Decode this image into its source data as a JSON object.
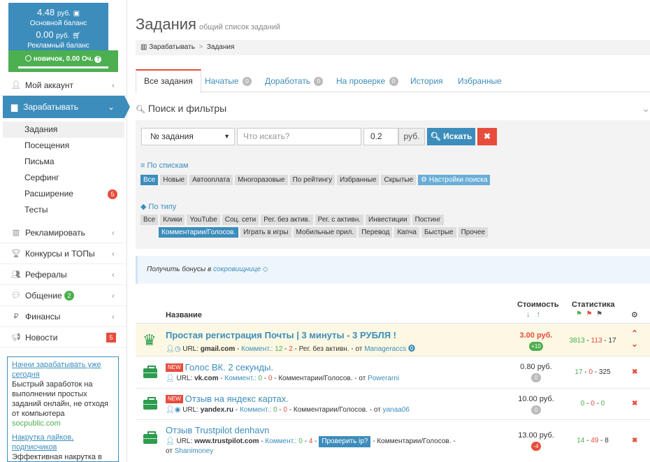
{
  "balance": {
    "main_amount": "4.48",
    "main_currency": "руб.",
    "main_label": "Основной баланс",
    "ad_amount": "0.00",
    "ad_currency": "руб.",
    "ad_label": "Рекламный баланс",
    "status": "новичок, 0.00 Оч."
  },
  "sidebar": {
    "items": [
      {
        "label": "Мой аккаунт"
      },
      {
        "label": "Зарабатывать"
      },
      {
        "label": "Рекламировать"
      },
      {
        "label": "Конкурсы и ТОПы"
      },
      {
        "label": "Рефералы"
      },
      {
        "label": "Общение",
        "badge": "2"
      },
      {
        "label": "Финансы"
      },
      {
        "label": "Новости",
        "badge": "5"
      }
    ],
    "sub_items": [
      {
        "label": "Задания"
      },
      {
        "label": "Посещения"
      },
      {
        "label": "Письма"
      },
      {
        "label": "Серфинг"
      },
      {
        "label": "Расширение",
        "badge": "5"
      },
      {
        "label": "Тесты"
      }
    ],
    "promo": {
      "link1": "Начни зарабатывать уже сегодня",
      "text1": "Быстрый заработок на выполнении простых заданий онлайн, не отходя от компьютера",
      "site1": "socpublic.com",
      "link2": "Накрутка лайков, подписчиков",
      "text2": "Эффективная накрутка в"
    }
  },
  "header": {
    "title": "Задания",
    "subtitle": "общий список заданий",
    "breadcrumb_root": "Зарабатывать",
    "breadcrumb_sep": ">",
    "breadcrumb_current": "Задания"
  },
  "tabs": [
    {
      "label": "Все задания"
    },
    {
      "label": "Начатые",
      "count": "0"
    },
    {
      "label": "Доработать",
      "count": "0"
    },
    {
      "label": "На проверке",
      "count": "0"
    },
    {
      "label": "История"
    },
    {
      "label": "Избранные"
    }
  ],
  "search": {
    "heading": "Поиск и фильтры",
    "select_value": "№ задания",
    "query_placeholder": "Что искать?",
    "price_value": "0.2",
    "currency": "руб.",
    "search_button": "Искать",
    "clear_button": "✖"
  },
  "filters": {
    "lists_title": "По спискам",
    "lists": [
      "Все",
      "Новые",
      "Автооплата",
      "Многоразовые",
      "По рейтингу",
      "Избранные",
      "Скрытые"
    ],
    "settings_label": "Настройки поиска",
    "types_title": "По типу",
    "types_row1": [
      "Все",
      "Клики",
      "YouTube",
      "Соц. сети",
      "Рег. без актив.",
      "Рег. с активн.",
      "Инвестиции",
      "Постинг"
    ],
    "types_row2": [
      "Комментарии/Голосов.",
      "Играть в игры",
      "Мобильные прил.",
      "Перевод",
      "Капча",
      "Быстрые",
      "Прочее"
    ]
  },
  "bonus": {
    "text": "Получить бонусы в",
    "link": "сокровищнице"
  },
  "table": {
    "col_name": "Название",
    "col_price": "Стоимость",
    "col_stats": "Статистика",
    "rows": [
      {
        "title": "Простая регистрация Почты | 3 минуты - 3 РУБЛЯ !",
        "url_label": "URL:",
        "url": "gmail.com",
        "comment_label": "Коммент.:",
        "c1": "12",
        "c2": "2",
        "category": "Рег. без активн.",
        "from": "от",
        "author": "Manageraccs",
        "price": "3.00 руб.",
        "price_badge": "+10",
        "stat": [
          "3813",
          "113",
          "17"
        ]
      },
      {
        "tag": "NEW",
        "title": "Голос ВК. 2 секунды.",
        "url_label": "URL:",
        "url": "vk.com",
        "comment_label": "Коммент.:",
        "c1": "0",
        "c2": "0",
        "category": "Комментарии/Голосов.",
        "from": "от",
        "author": "Powerarni",
        "price": "0.80 руб.",
        "price_badge": "0",
        "stat": [
          "17",
          "0",
          "325"
        ]
      },
      {
        "tag": "NEW",
        "title": "Отзыв на яндекс картах.",
        "url_label": "URL:",
        "url": "yandex.ru",
        "comment_label": "Коммент.:",
        "c1": "0",
        "c2": "0",
        "category": "Комментарии/Голосов.",
        "from": "от",
        "author": "yanaa06",
        "price": "10.00 руб.",
        "price_badge": "0",
        "stat": [
          "0",
          "0",
          "0"
        ]
      },
      {
        "title": "Отзыв Trustpilot denhavn",
        "url_label": "URL:",
        "url": "www.trustpilot.com",
        "comment_label": "Коммент.:",
        "c1": "0",
        "c2": "4",
        "check_button": "Проверить ip?",
        "category": "Комментарии/Голосов.",
        "from": "от",
        "author": "Shanimoney",
        "price": "13.00 руб.",
        "price_badge": "-4",
        "stat": [
          "14",
          "49",
          "8"
        ]
      }
    ]
  }
}
